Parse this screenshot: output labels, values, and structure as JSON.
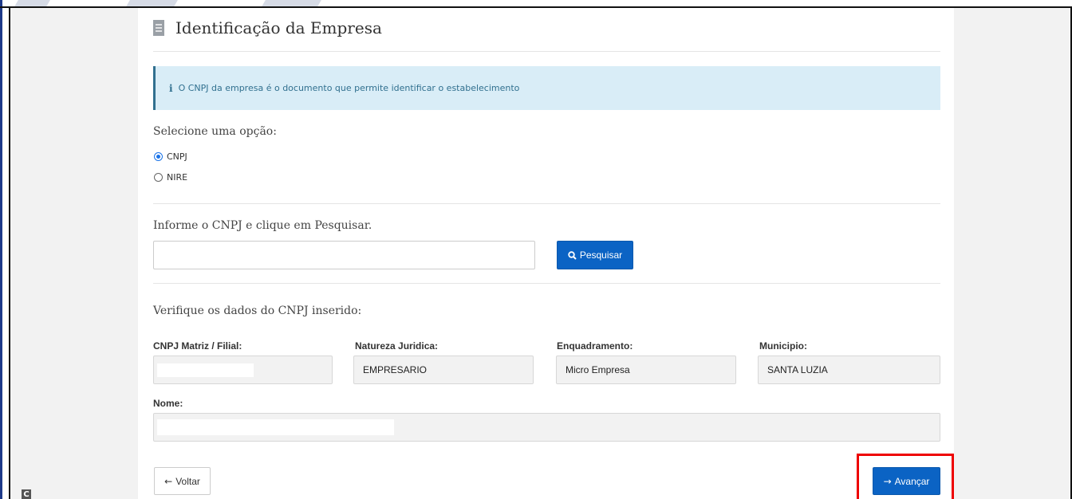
{
  "section": {
    "title": "Identificação da Empresa",
    "icon": "building-icon"
  },
  "alert": {
    "icon": "info-icon",
    "icon_glyph": "i",
    "text": "O CNPJ da empresa é o documento que permite identificar o estabelecimento"
  },
  "selection": {
    "label": "Selecione uma opção:",
    "options": [
      {
        "label": "CNPJ",
        "selected": true
      },
      {
        "label": "NIRE",
        "selected": false
      }
    ]
  },
  "search": {
    "label": "Informe o CNPJ e clique em Pesquisar.",
    "value": "",
    "button_label": "Pesquisar",
    "button_icon": "search-icon"
  },
  "verify": {
    "label": "Verifique os dados do CNPJ inserido:",
    "fields": {
      "cnpj_label": "CNPJ Matriz / Filial:",
      "cnpj_value": "",
      "natureza_label": "Natureza Juridica:",
      "natureza_value": "EMPRESARIO",
      "enquadramento_label": "Enquadramento:",
      "enquadramento_value": "Micro Empresa",
      "municipio_label": "Municipio:",
      "municipio_value": "SANTA LUZIA",
      "nome_label": "Nome:",
      "nome_value": ""
    }
  },
  "actions": {
    "back_label": "Voltar",
    "back_icon": "arrow-left-icon",
    "next_label": "Avançar",
    "next_icon": "arrow-right-icon"
  },
  "colors": {
    "primary": "#0b63c4",
    "alert_bg": "#d9edf7",
    "alert_text": "#31708f",
    "highlight": "#ee0000"
  },
  "corner_badge": "C"
}
